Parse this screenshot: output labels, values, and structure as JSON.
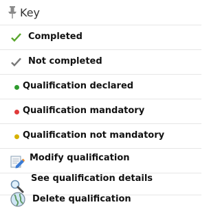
{
  "key": {
    "title": "Key",
    "items": [
      {
        "label": "Completed",
        "icon": "check-green-icon",
        "color": "#5aa62e"
      },
      {
        "label": "Not completed",
        "icon": "check-gray-icon",
        "color": "#777777"
      },
      {
        "label": "Qualification declared",
        "icon": "dot-green-icon",
        "color": "#2e9b2e"
      },
      {
        "label": "Qualification mandatory",
        "icon": "dot-red-icon",
        "color": "#e03a3a"
      },
      {
        "label": "Qualification not mandatory",
        "icon": "dot-yellow-icon",
        "color": "#d6b100"
      },
      {
        "label": "Modify qualification",
        "icon": "edit-document-icon"
      },
      {
        "label": "See qualification details",
        "icon": "magnifier-icon"
      },
      {
        "label": "Delete qualification",
        "icon": "delete-globe-icon"
      }
    ]
  }
}
